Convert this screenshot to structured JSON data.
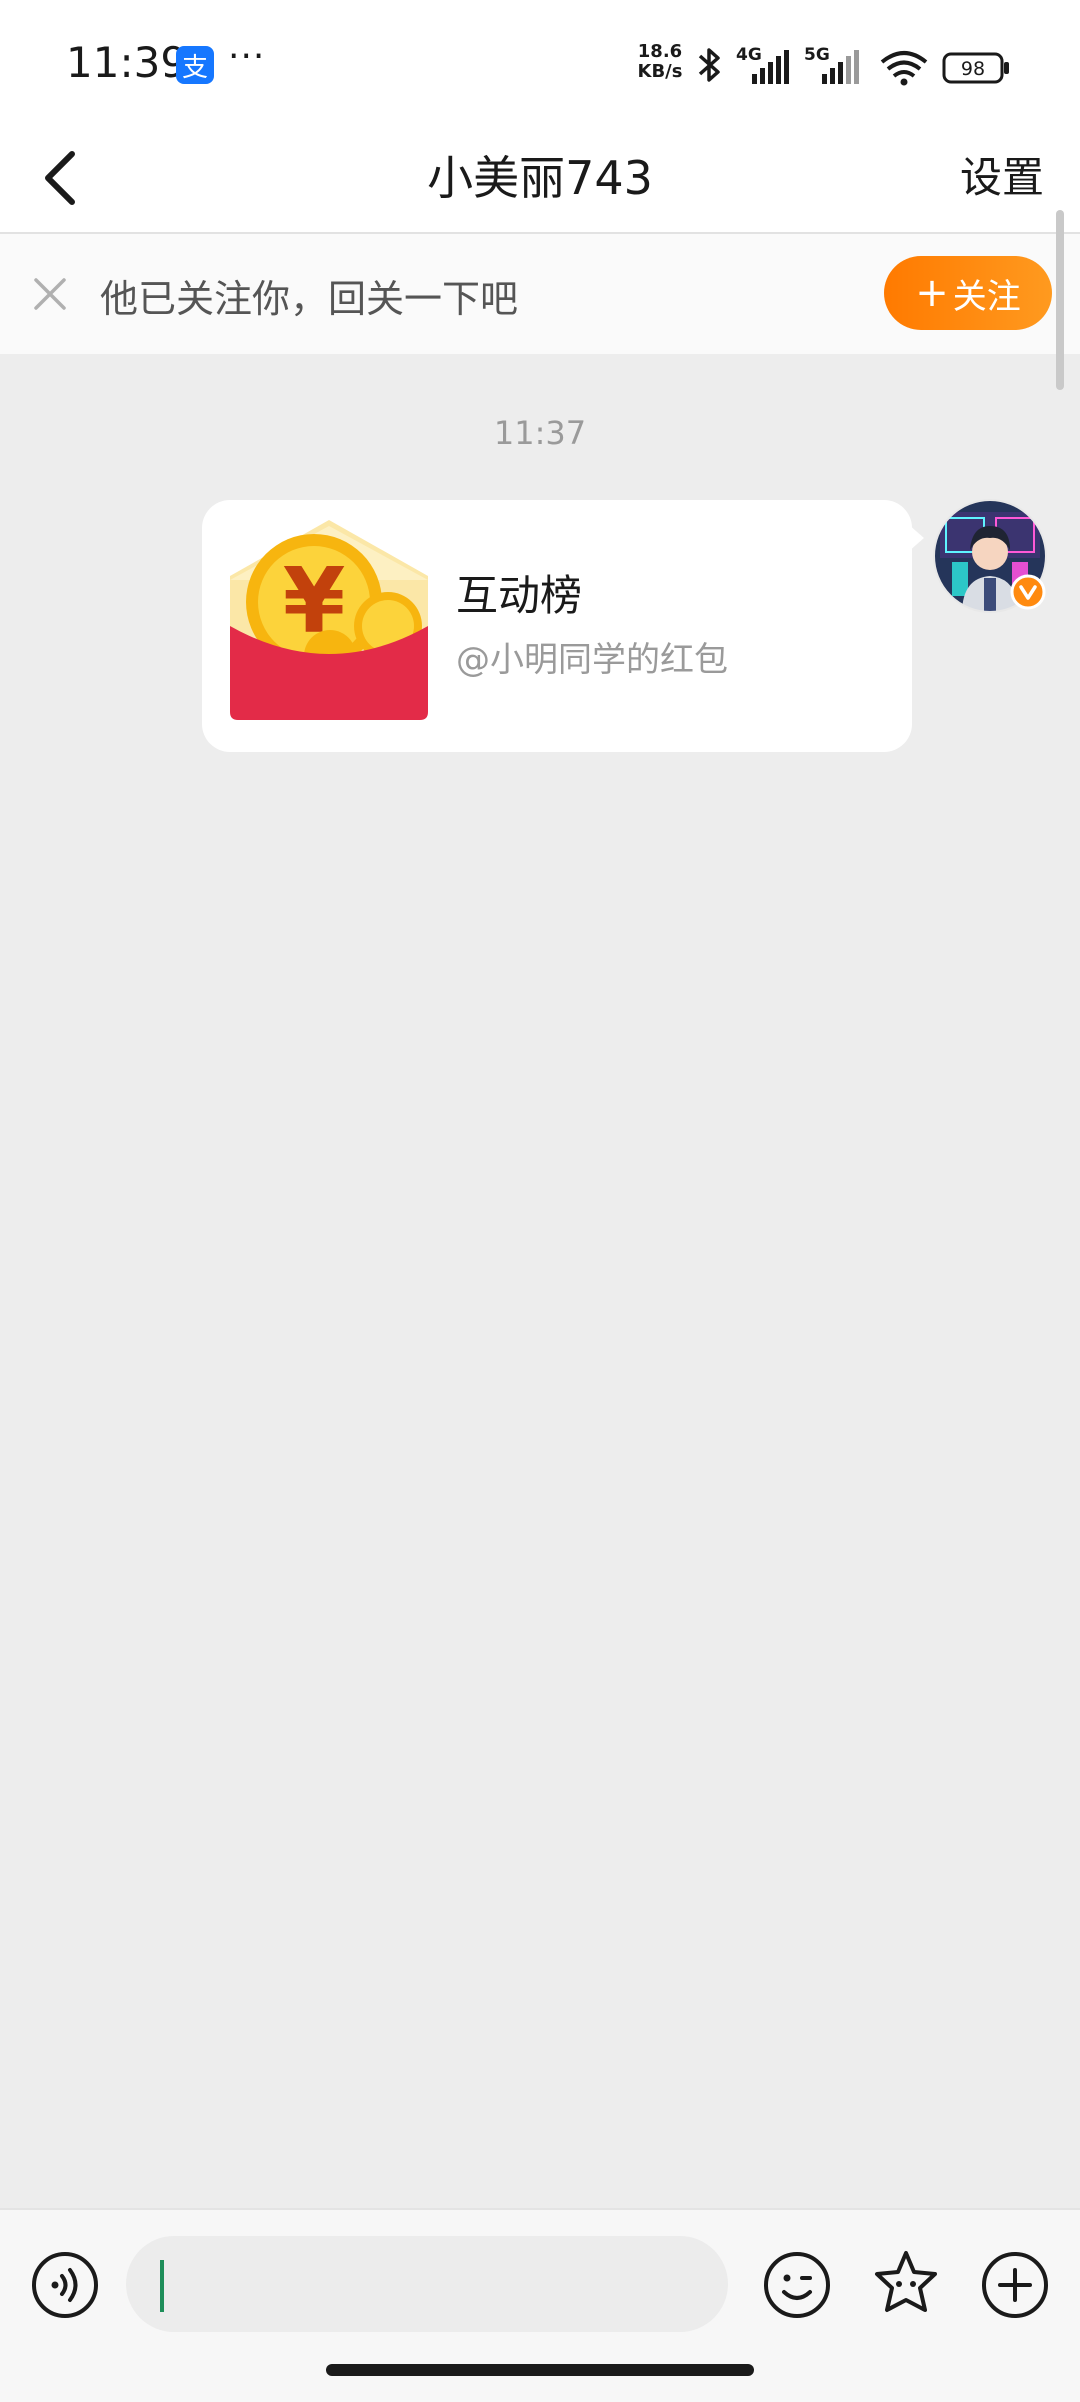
{
  "status_bar": {
    "time": "11:39",
    "alipay_glyph": "支",
    "more": "···",
    "net_speed_value": "18.6",
    "net_speed_unit": "KB/s",
    "lte_label": "4G",
    "fiveg_label": "5G",
    "battery": "98",
    "icons": [
      "bluetooth-icon",
      "signal-icon",
      "wifi-icon",
      "battery-icon"
    ]
  },
  "header": {
    "title": "小美丽743",
    "settings_label": "设置"
  },
  "follow_bar": {
    "message": "他已关注你，回关一下吧",
    "button_plus": "+",
    "button_label": "关注"
  },
  "chat": {
    "timestamp": "11:37",
    "card": {
      "title": "互动榜",
      "subtitle": "@小明同学的红包",
      "envelope_glyph": "¥"
    }
  },
  "input_bar": {
    "placeholder": "",
    "icons": [
      "voice-icon",
      "emoji-icon",
      "sticker-icon",
      "plus-icon"
    ]
  },
  "colors": {
    "accent_orange": "#ff8a0f",
    "envelope_red": "#e32b48",
    "coin_gold": "#f9c31a",
    "background": "#ededed",
    "cursor_green": "#1e8e5a"
  }
}
